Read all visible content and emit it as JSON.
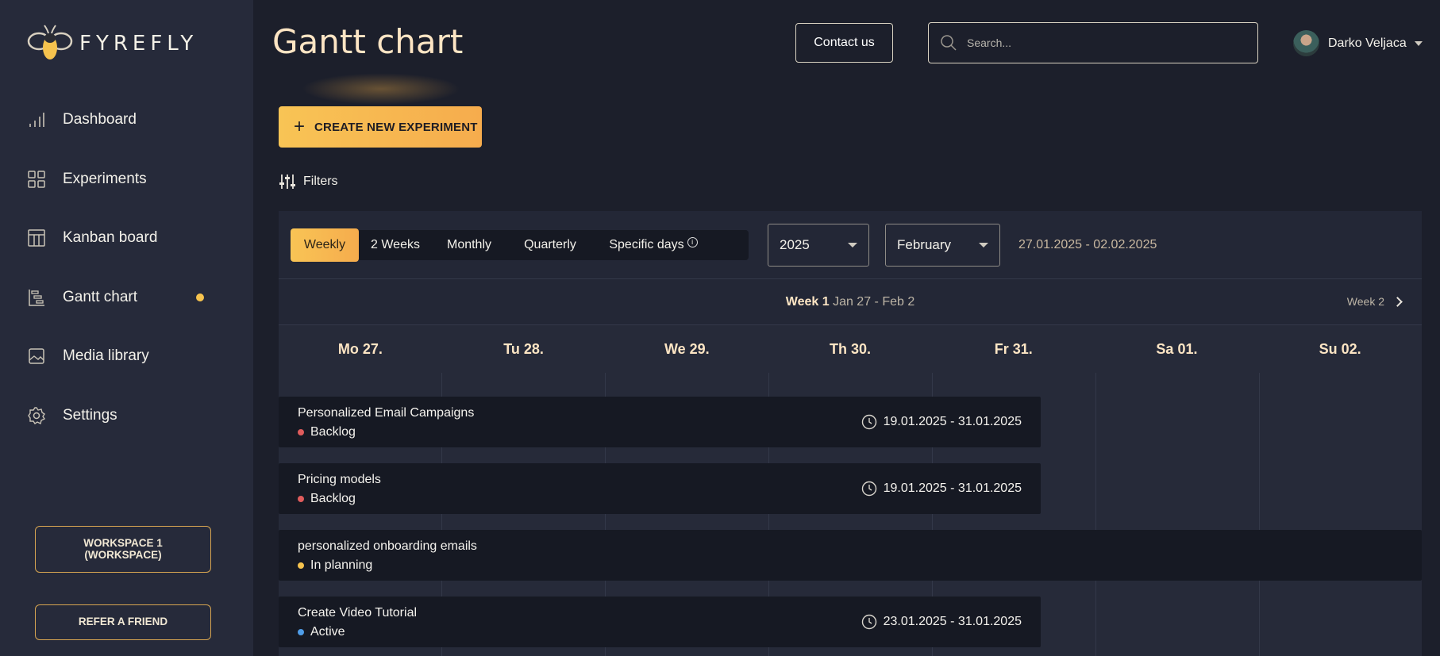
{
  "brand": {
    "name": "FYREFLY",
    "accent": "#f6c34e"
  },
  "sidebar": {
    "items": [
      {
        "label": "Dashboard",
        "icon": "bar-chart-icon"
      },
      {
        "label": "Experiments",
        "icon": "grid-icon"
      },
      {
        "label": "Kanban board",
        "icon": "kanban-icon"
      },
      {
        "label": "Gantt chart",
        "icon": "gantt-icon",
        "active": true
      },
      {
        "label": "Media library",
        "icon": "image-icon"
      },
      {
        "label": "Settings",
        "icon": "gear-icon"
      }
    ],
    "workspace_line1": "WORKSPACE 1",
    "workspace_line2": "(WORKSPACE)",
    "refer_label": "REFER A FRIEND"
  },
  "header": {
    "title": "Gantt chart",
    "contact_label": "Contact us",
    "search_placeholder": "Search...",
    "user_name": "Darko Veljaca"
  },
  "toolbar": {
    "create_label": "CREATE NEW EXPERIMENT",
    "filters_label": "Filters"
  },
  "view": {
    "tabs": [
      "Weekly",
      "2 Weeks",
      "Monthly",
      "Quarterly",
      "Specific days"
    ],
    "active_tab": "Weekly",
    "year": "2025",
    "month": "February",
    "range": "27.01.2025 - 02.02.2025"
  },
  "week": {
    "label": "Week 1",
    "dates": "Jan 27 - Feb 2",
    "next_label": "Week 2"
  },
  "days": [
    "Mo 27.",
    "Tu 28.",
    "We 29.",
    "Th 30.",
    "Fr 31.",
    "Sa 01.",
    "Su 02."
  ],
  "tasks": [
    {
      "name": "Personalized Email Campaigns",
      "status": "Backlog",
      "status_color": "#e05c5c",
      "date_range": "19.01.2025 - 31.01.2025"
    },
    {
      "name": "Pricing models",
      "status": "Backlog",
      "status_color": "#e05c5c",
      "date_range": "19.01.2025 - 31.01.2025"
    },
    {
      "name": "personalized onboarding emails",
      "status": "In planning",
      "status_color": "#f6c34e",
      "date_range": ""
    },
    {
      "name": "Create Video Tutorial",
      "status": "Active",
      "status_color": "#4f9de8",
      "date_range": "23.01.2025 - 31.01.2025"
    }
  ]
}
